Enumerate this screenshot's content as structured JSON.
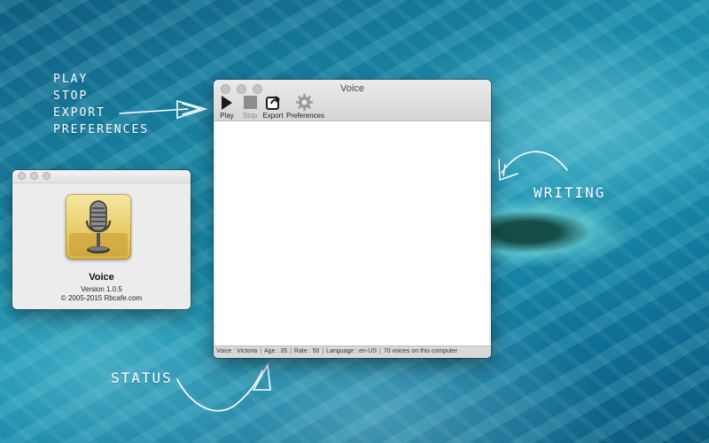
{
  "annotations": {
    "toolbar_items": [
      "PLAY",
      "STOP",
      "EXPORT",
      "PREFERENCES"
    ],
    "writing": "WRITING",
    "status": "STATUS"
  },
  "about_window": {
    "app_name": "Voice",
    "version": "Version 1.0.5",
    "copyright": "© 2005-2015 Rbcafe.com",
    "icon": "microphone-icon"
  },
  "main_window": {
    "title": "Voice",
    "toolbar": {
      "play_label": "Play",
      "stop_label": "Stop",
      "export_label": "Export",
      "preferences_label": "Preferences"
    },
    "editor_text": "",
    "status": {
      "voice": "Voice : Victoria",
      "age": "Age : 35",
      "rate": "Rate : 50",
      "language": "Language : en-US",
      "count": "70 voices on this computer"
    }
  },
  "colors": {
    "window_bg": "#ececec",
    "desktop": "#1a87a6",
    "annotation": "#ffffff"
  }
}
